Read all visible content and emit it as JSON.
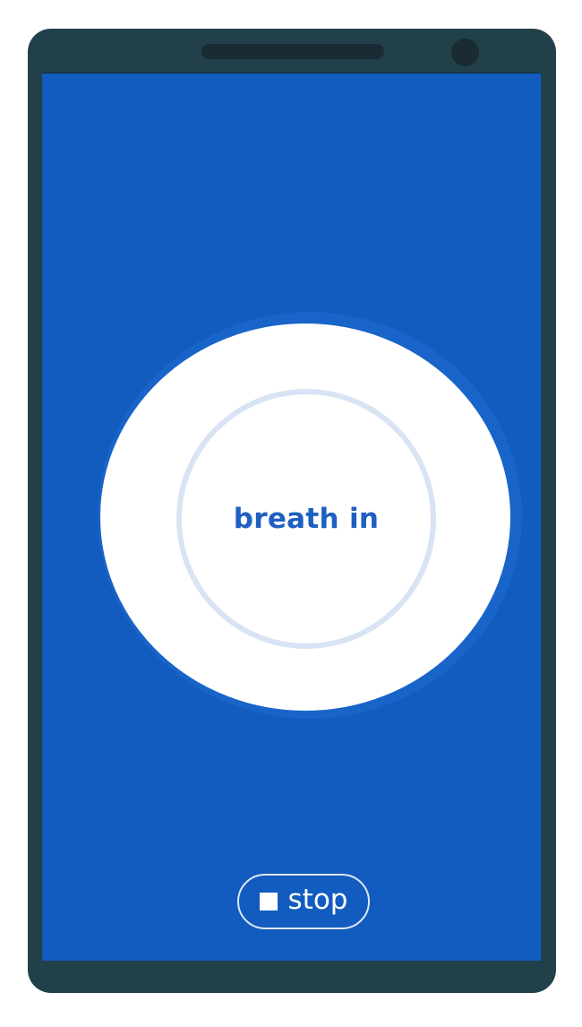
{
  "app": {
    "phase_text": "breath in"
  },
  "controls": {
    "stop_label": "stop",
    "stop_icon": "stop-square-icon"
  },
  "colors": {
    "screen_background": "#125bbf",
    "circle_fill": "#ffffff",
    "ring_stroke": "#d8e3f4",
    "text_accent": "#1f5fbf",
    "device_frame": "#22404a"
  }
}
